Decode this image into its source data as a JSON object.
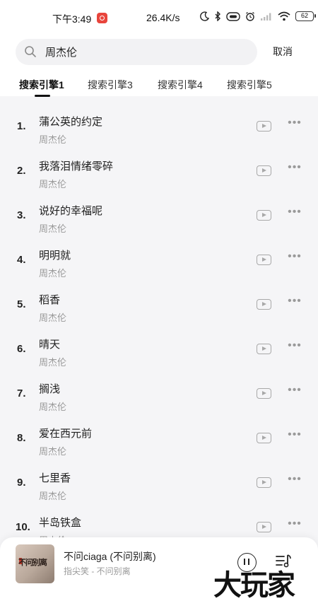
{
  "status_bar": {
    "time": "下午3:49",
    "net_speed": "26.4K/s",
    "battery": "62",
    "icons": [
      "app-notification-icon",
      "moon-icon",
      "bluetooth-icon",
      "hd-icon",
      "alarm-icon",
      "signal-icon",
      "wifi-icon",
      "battery-icon"
    ]
  },
  "search": {
    "query": "周杰伦",
    "cancel_label": "取消"
  },
  "tabs": [
    {
      "label": "搜索引擎1",
      "active": true
    },
    {
      "label": "搜索引擎3",
      "active": false
    },
    {
      "label": "搜索引擎4",
      "active": false
    },
    {
      "label": "搜索引擎5",
      "active": false
    }
  ],
  "songs": [
    {
      "num": "1.",
      "title": "蒲公英的约定",
      "artist": "周杰伦"
    },
    {
      "num": "2.",
      "title": "我落泪情绪零碎",
      "artist": "周杰伦"
    },
    {
      "num": "3.",
      "title": "说好的幸福呢",
      "artist": "周杰伦"
    },
    {
      "num": "4.",
      "title": "明明就",
      "artist": "周杰伦"
    },
    {
      "num": "5.",
      "title": "稻香",
      "artist": "周杰伦"
    },
    {
      "num": "6.",
      "title": "晴天",
      "artist": "周杰伦"
    },
    {
      "num": "7.",
      "title": "搁浅",
      "artist": "周杰伦"
    },
    {
      "num": "8.",
      "title": "爱在西元前",
      "artist": "周杰伦"
    },
    {
      "num": "9.",
      "title": "七里香",
      "artist": "周杰伦"
    },
    {
      "num": "10.",
      "title": "半岛铁盒",
      "artist": "周杰伦"
    }
  ],
  "now_playing": {
    "title": "不问ciaga (不问别离)",
    "subtitle": "指尖笑 - 不问别离",
    "cover_text": "不问别离"
  },
  "watermark": "大玩家",
  "colors": {
    "page_bg": "#f5f5f7",
    "header_bg": "#ffffff",
    "secondary_text": "#9a9a9a",
    "app_icon_red": "#e8453c"
  }
}
